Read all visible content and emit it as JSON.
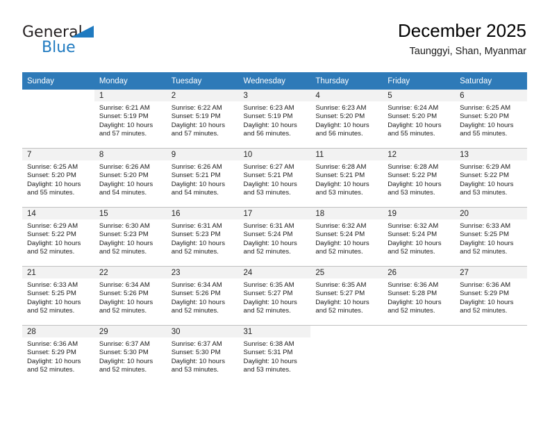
{
  "brand": {
    "name_top": "General",
    "name_bottom": "Blue",
    "accent_color": "#1f7ac0"
  },
  "header": {
    "title": "December 2025",
    "subtitle": "Taunggyi, Shan, Myanmar"
  },
  "calendar": {
    "header_bg": "#2e7ab8",
    "daynum_bg": "#f2f2f2",
    "weekday_headers": [
      "Sunday",
      "Monday",
      "Tuesday",
      "Wednesday",
      "Thursday",
      "Friday",
      "Saturday"
    ],
    "labels": {
      "sunrise_prefix": "Sunrise:",
      "sunset_prefix": "Sunset:",
      "daylight_prefix": "Daylight:"
    },
    "weeks": [
      [
        {
          "day": "",
          "sunrise": "",
          "sunset": "",
          "daylight_line1": "",
          "daylight_line2": ""
        },
        {
          "day": "1",
          "sunrise": "Sunrise: 6:21 AM",
          "sunset": "Sunset: 5:19 PM",
          "daylight_line1": "Daylight: 10 hours",
          "daylight_line2": "and 57 minutes."
        },
        {
          "day": "2",
          "sunrise": "Sunrise: 6:22 AM",
          "sunset": "Sunset: 5:19 PM",
          "daylight_line1": "Daylight: 10 hours",
          "daylight_line2": "and 57 minutes."
        },
        {
          "day": "3",
          "sunrise": "Sunrise: 6:23 AM",
          "sunset": "Sunset: 5:19 PM",
          "daylight_line1": "Daylight: 10 hours",
          "daylight_line2": "and 56 minutes."
        },
        {
          "day": "4",
          "sunrise": "Sunrise: 6:23 AM",
          "sunset": "Sunset: 5:20 PM",
          "daylight_line1": "Daylight: 10 hours",
          "daylight_line2": "and 56 minutes."
        },
        {
          "day": "5",
          "sunrise": "Sunrise: 6:24 AM",
          "sunset": "Sunset: 5:20 PM",
          "daylight_line1": "Daylight: 10 hours",
          "daylight_line2": "and 55 minutes."
        },
        {
          "day": "6",
          "sunrise": "Sunrise: 6:25 AM",
          "sunset": "Sunset: 5:20 PM",
          "daylight_line1": "Daylight: 10 hours",
          "daylight_line2": "and 55 minutes."
        }
      ],
      [
        {
          "day": "7",
          "sunrise": "Sunrise: 6:25 AM",
          "sunset": "Sunset: 5:20 PM",
          "daylight_line1": "Daylight: 10 hours",
          "daylight_line2": "and 55 minutes."
        },
        {
          "day": "8",
          "sunrise": "Sunrise: 6:26 AM",
          "sunset": "Sunset: 5:20 PM",
          "daylight_line1": "Daylight: 10 hours",
          "daylight_line2": "and 54 minutes."
        },
        {
          "day": "9",
          "sunrise": "Sunrise: 6:26 AM",
          "sunset": "Sunset: 5:21 PM",
          "daylight_line1": "Daylight: 10 hours",
          "daylight_line2": "and 54 minutes."
        },
        {
          "day": "10",
          "sunrise": "Sunrise: 6:27 AM",
          "sunset": "Sunset: 5:21 PM",
          "daylight_line1": "Daylight: 10 hours",
          "daylight_line2": "and 53 minutes."
        },
        {
          "day": "11",
          "sunrise": "Sunrise: 6:28 AM",
          "sunset": "Sunset: 5:21 PM",
          "daylight_line1": "Daylight: 10 hours",
          "daylight_line2": "and 53 minutes."
        },
        {
          "day": "12",
          "sunrise": "Sunrise: 6:28 AM",
          "sunset": "Sunset: 5:22 PM",
          "daylight_line1": "Daylight: 10 hours",
          "daylight_line2": "and 53 minutes."
        },
        {
          "day": "13",
          "sunrise": "Sunrise: 6:29 AM",
          "sunset": "Sunset: 5:22 PM",
          "daylight_line1": "Daylight: 10 hours",
          "daylight_line2": "and 53 minutes."
        }
      ],
      [
        {
          "day": "14",
          "sunrise": "Sunrise: 6:29 AM",
          "sunset": "Sunset: 5:22 PM",
          "daylight_line1": "Daylight: 10 hours",
          "daylight_line2": "and 52 minutes."
        },
        {
          "day": "15",
          "sunrise": "Sunrise: 6:30 AM",
          "sunset": "Sunset: 5:23 PM",
          "daylight_line1": "Daylight: 10 hours",
          "daylight_line2": "and 52 minutes."
        },
        {
          "day": "16",
          "sunrise": "Sunrise: 6:31 AM",
          "sunset": "Sunset: 5:23 PM",
          "daylight_line1": "Daylight: 10 hours",
          "daylight_line2": "and 52 minutes."
        },
        {
          "day": "17",
          "sunrise": "Sunrise: 6:31 AM",
          "sunset": "Sunset: 5:24 PM",
          "daylight_line1": "Daylight: 10 hours",
          "daylight_line2": "and 52 minutes."
        },
        {
          "day": "18",
          "sunrise": "Sunrise: 6:32 AM",
          "sunset": "Sunset: 5:24 PM",
          "daylight_line1": "Daylight: 10 hours",
          "daylight_line2": "and 52 minutes."
        },
        {
          "day": "19",
          "sunrise": "Sunrise: 6:32 AM",
          "sunset": "Sunset: 5:24 PM",
          "daylight_line1": "Daylight: 10 hours",
          "daylight_line2": "and 52 minutes."
        },
        {
          "day": "20",
          "sunrise": "Sunrise: 6:33 AM",
          "sunset": "Sunset: 5:25 PM",
          "daylight_line1": "Daylight: 10 hours",
          "daylight_line2": "and 52 minutes."
        }
      ],
      [
        {
          "day": "21",
          "sunrise": "Sunrise: 6:33 AM",
          "sunset": "Sunset: 5:25 PM",
          "daylight_line1": "Daylight: 10 hours",
          "daylight_line2": "and 52 minutes."
        },
        {
          "day": "22",
          "sunrise": "Sunrise: 6:34 AM",
          "sunset": "Sunset: 5:26 PM",
          "daylight_line1": "Daylight: 10 hours",
          "daylight_line2": "and 52 minutes."
        },
        {
          "day": "23",
          "sunrise": "Sunrise: 6:34 AM",
          "sunset": "Sunset: 5:26 PM",
          "daylight_line1": "Daylight: 10 hours",
          "daylight_line2": "and 52 minutes."
        },
        {
          "day": "24",
          "sunrise": "Sunrise: 6:35 AM",
          "sunset": "Sunset: 5:27 PM",
          "daylight_line1": "Daylight: 10 hours",
          "daylight_line2": "and 52 minutes."
        },
        {
          "day": "25",
          "sunrise": "Sunrise: 6:35 AM",
          "sunset": "Sunset: 5:27 PM",
          "daylight_line1": "Daylight: 10 hours",
          "daylight_line2": "and 52 minutes."
        },
        {
          "day": "26",
          "sunrise": "Sunrise: 6:36 AM",
          "sunset": "Sunset: 5:28 PM",
          "daylight_line1": "Daylight: 10 hours",
          "daylight_line2": "and 52 minutes."
        },
        {
          "day": "27",
          "sunrise": "Sunrise: 6:36 AM",
          "sunset": "Sunset: 5:29 PM",
          "daylight_line1": "Daylight: 10 hours",
          "daylight_line2": "and 52 minutes."
        }
      ],
      [
        {
          "day": "28",
          "sunrise": "Sunrise: 6:36 AM",
          "sunset": "Sunset: 5:29 PM",
          "daylight_line1": "Daylight: 10 hours",
          "daylight_line2": "and 52 minutes."
        },
        {
          "day": "29",
          "sunrise": "Sunrise: 6:37 AM",
          "sunset": "Sunset: 5:30 PM",
          "daylight_line1": "Daylight: 10 hours",
          "daylight_line2": "and 52 minutes."
        },
        {
          "day": "30",
          "sunrise": "Sunrise: 6:37 AM",
          "sunset": "Sunset: 5:30 PM",
          "daylight_line1": "Daylight: 10 hours",
          "daylight_line2": "and 53 minutes."
        },
        {
          "day": "31",
          "sunrise": "Sunrise: 6:38 AM",
          "sunset": "Sunset: 5:31 PM",
          "daylight_line1": "Daylight: 10 hours",
          "daylight_line2": "and 53 minutes."
        },
        {
          "day": "",
          "sunrise": "",
          "sunset": "",
          "daylight_line1": "",
          "daylight_line2": ""
        },
        {
          "day": "",
          "sunrise": "",
          "sunset": "",
          "daylight_line1": "",
          "daylight_line2": ""
        },
        {
          "day": "",
          "sunrise": "",
          "sunset": "",
          "daylight_line1": "",
          "daylight_line2": ""
        }
      ]
    ]
  }
}
